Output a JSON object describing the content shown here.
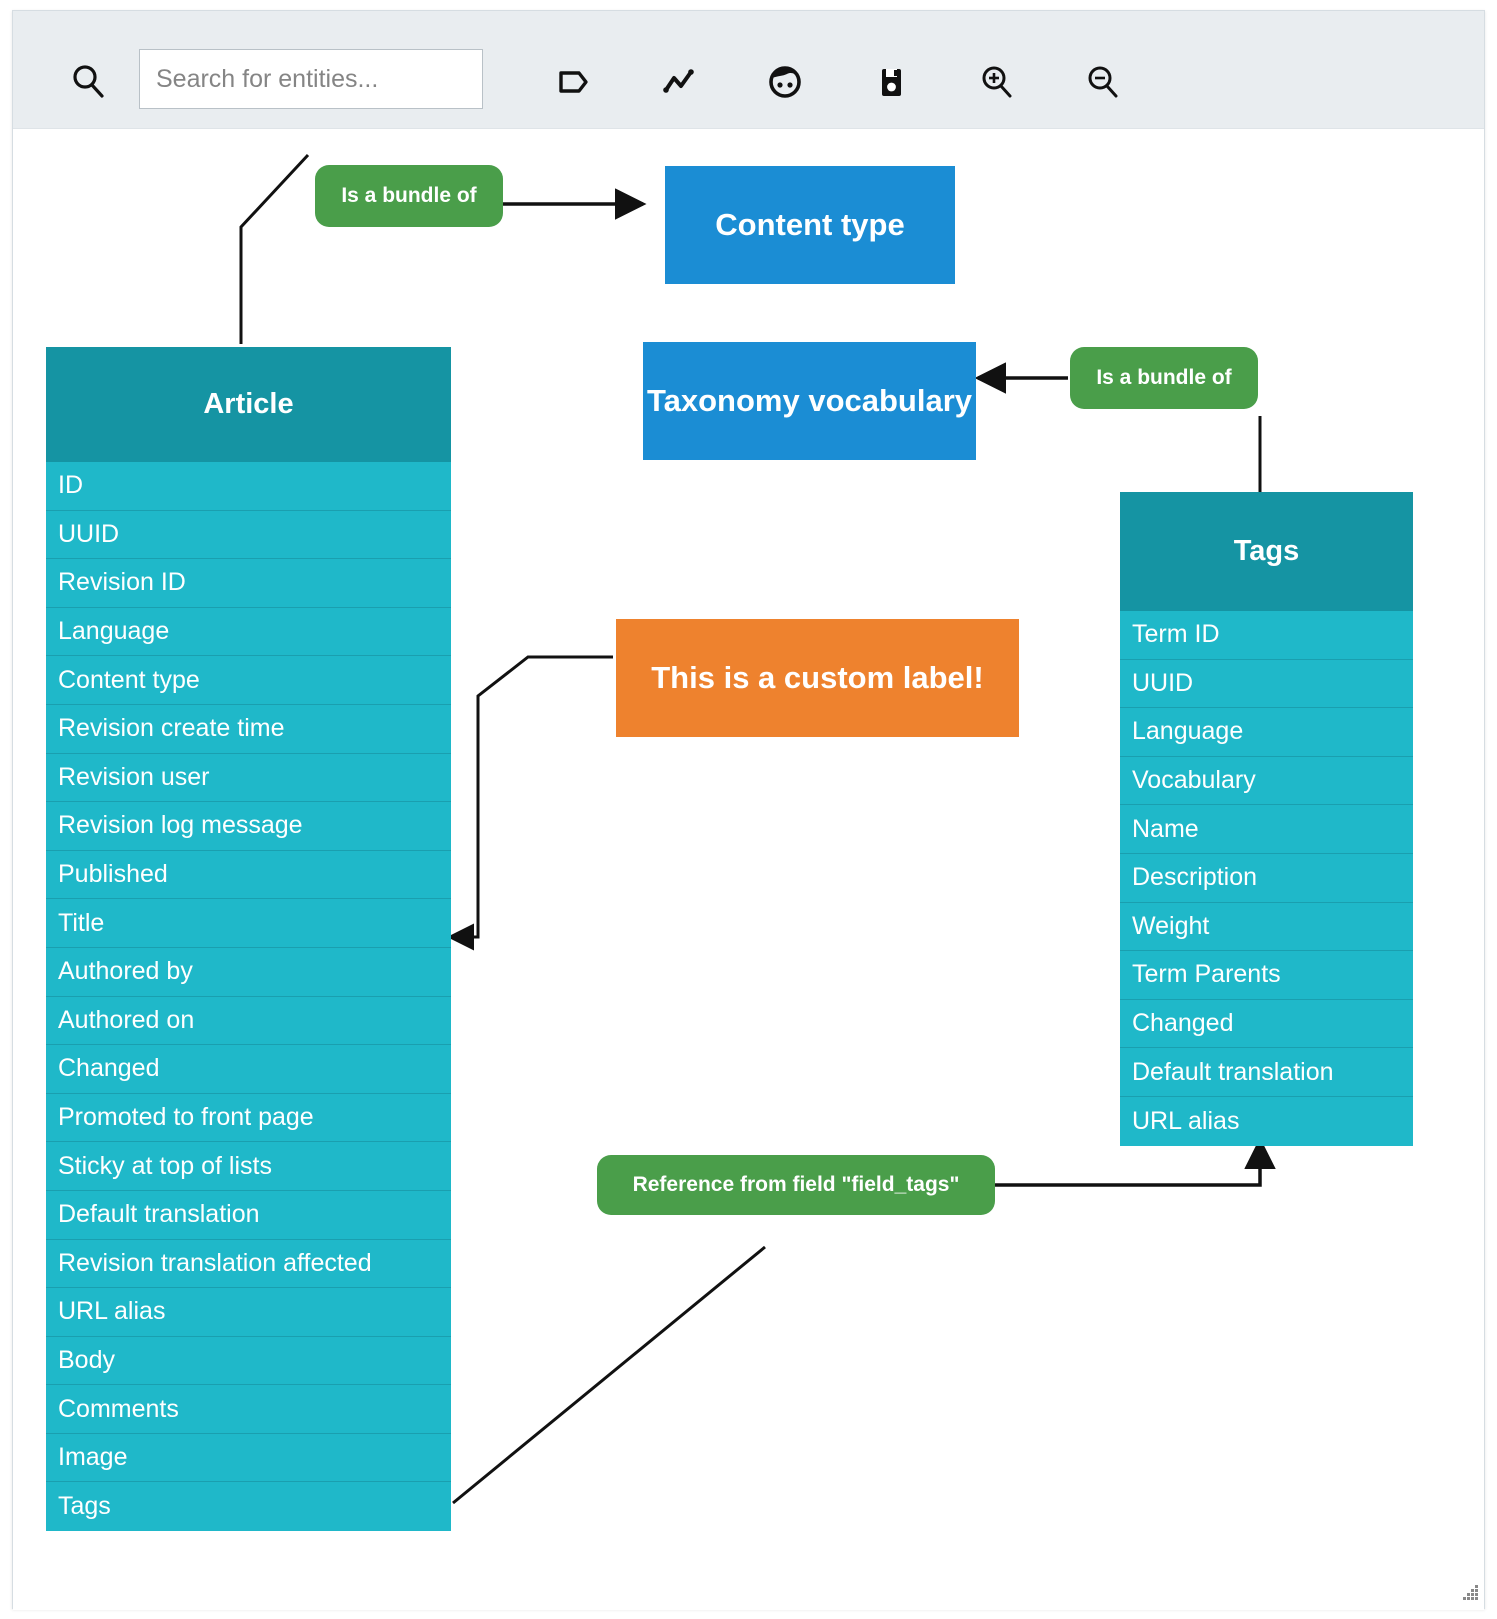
{
  "toolbar": {
    "search_icon": "search-icon",
    "search": {
      "value": "",
      "placeholder": "Search for entities..."
    },
    "buttons": [
      {
        "name": "tag-icon",
        "label": "Add label"
      },
      {
        "name": "polyline-icon",
        "label": "Add relation"
      },
      {
        "name": "face-icon",
        "label": "Add entity"
      },
      {
        "name": "save-icon",
        "label": "Save"
      },
      {
        "name": "zoom-in-icon",
        "label": "Zoom in"
      },
      {
        "name": "zoom-out-icon",
        "label": "Zoom out"
      }
    ]
  },
  "colors": {
    "toolbar_bg": "#e9edf0",
    "canvas_bg": "#ffffff",
    "entity_header": "#1594a3",
    "entity_row": "#1fb8c9",
    "bundle_box": "#1b8dd4",
    "relation_pill": "#4a9e4a",
    "custom_label": "#ee822e",
    "edge": "#111111"
  },
  "diagram": {
    "labels": {
      "bundle_of_content_type": "Is a bundle of",
      "bundle_of_taxonomy": "Is a bundle of",
      "custom_label": "This is a custom label!",
      "field_tags_reference": "Reference from field \"field_tags\""
    },
    "boxes": {
      "content_type": "Content type",
      "taxonomy_vocabulary": "Taxonomy vocabulary"
    },
    "entities": [
      {
        "name": "Article",
        "fields": [
          "ID",
          "UUID",
          "Revision ID",
          "Language",
          "Content type",
          "Revision create time",
          "Revision user",
          "Revision log message",
          "Published",
          "Title",
          "Authored by",
          "Authored on",
          "Changed",
          "Promoted to front page",
          "Sticky at top of lists",
          "Default translation",
          "Revision translation affected",
          "URL alias",
          "Body",
          "Comments",
          "Image",
          "Tags"
        ]
      },
      {
        "name": "Tags",
        "fields": [
          "Term ID",
          "UUID",
          "Language",
          "Vocabulary",
          "Name",
          "Description",
          "Weight",
          "Term Parents",
          "Changed",
          "Default translation",
          "URL alias"
        ]
      }
    ]
  }
}
